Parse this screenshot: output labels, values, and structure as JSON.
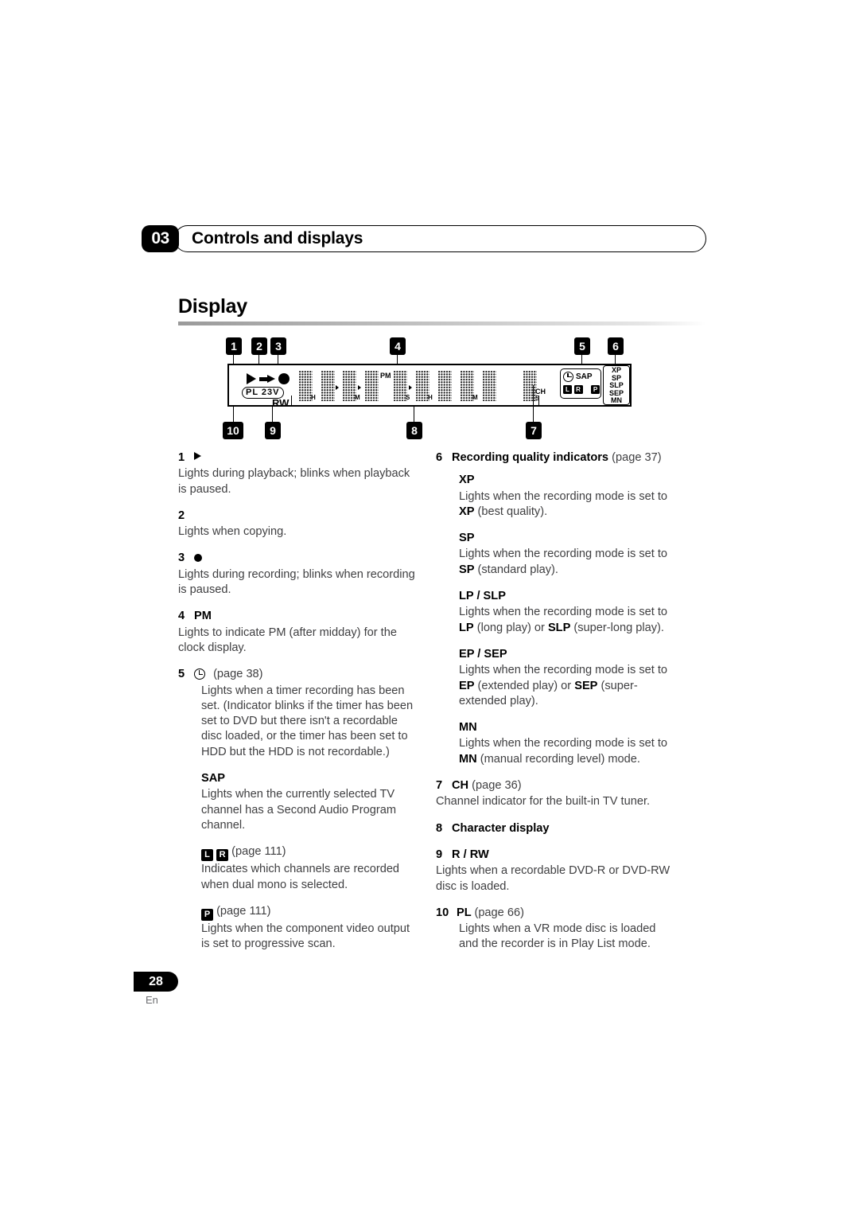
{
  "header": {
    "chapter_number": "03",
    "chapter_title": "Controls and displays"
  },
  "section": {
    "title": "Display"
  },
  "diagram": {
    "name": "front-panel-display-diagram",
    "callouts": [
      "1",
      "2",
      "3",
      "4",
      "5",
      "6",
      "7",
      "8",
      "9",
      "10"
    ],
    "panel": {
      "play_icon": "play-triangle-icon",
      "copy_icon": "copy-arrow-icon",
      "record_icon": "record-dot-icon",
      "pl_box_text": "PL 23V",
      "rw_label": "RW",
      "pm_label": "PM",
      "ch_label": "CH",
      "unit_labels": [
        "H",
        "M",
        "S",
        "H",
        "M",
        "S"
      ],
      "status": {
        "clock_icon": "clock-icon",
        "sap_label": "SAP",
        "channel_boxes": [
          "L",
          "R",
          "P"
        ]
      },
      "quality_indicators": [
        "XP",
        "SP",
        "SLP",
        "SEP",
        "MN"
      ]
    }
  },
  "left_column": [
    {
      "num": "1",
      "glyph": "play-triangle-icon",
      "label": "",
      "page": "",
      "body": "Lights during playback; blinks when playback is paused."
    },
    {
      "num": "2",
      "glyph": "copy-arrow-icon",
      "label": "",
      "page": "",
      "body": "Lights when copying."
    },
    {
      "num": "3",
      "glyph": "record-dot-icon",
      "label": "",
      "page": "",
      "body": "Lights during recording; blinks when recording is paused."
    },
    {
      "num": "4",
      "glyph": "",
      "label": "PM",
      "page": "",
      "body": "Lights to indicate PM (after midday) for the clock display."
    },
    {
      "num": "5",
      "glyph": "clock-icon",
      "label": "",
      "page": "(page 38)",
      "body": "Lights when a timer recording has been set. (Indicator blinks if the timer has been set to DVD but there isn't a recordable disc loaded, or the timer has been set to HDD but the HDD is not recordable.)"
    }
  ],
  "left_column_subitems": [
    {
      "head": "SAP",
      "page": "",
      "body": "Lights when the currently selected TV channel has a Second Audio Program channel."
    },
    {
      "head": "L R",
      "head_icons": [
        "L",
        "R"
      ],
      "page": "(page 111)",
      "body": "Indicates which channels are recorded when dual mono is selected."
    },
    {
      "head": "P",
      "head_icons": [
        "P"
      ],
      "page": "(page 111)",
      "body": "Lights when the component video output is set to progressive scan."
    }
  ],
  "right_column": {
    "item6": {
      "num": "6",
      "label": "Recording quality indicators",
      "page": "(page 37)",
      "modes": [
        {
          "head": "XP",
          "body_pre": "Lights when the recording mode is set to ",
          "body_bold": "XP",
          "body_post": " (best quality)."
        },
        {
          "head": "SP",
          "body_pre": "Lights when the recording mode is set to ",
          "body_bold": "SP",
          "body_post": " (standard play)."
        },
        {
          "head": "LP / SLP",
          "body_pre": "Lights when the recording mode is set to ",
          "body_bold": "LP",
          "body_mid": " (long play) or ",
          "body_bold2": "SLP",
          "body_post": " (super-long play)."
        },
        {
          "head": "EP / SEP",
          "body_pre": "Lights when the recording mode is set to ",
          "body_bold": "EP",
          "body_mid": " (extended play) or ",
          "body_bold2": "SEP",
          "body_post": " (super-extended play)."
        },
        {
          "head": "MN",
          "body_pre": "Lights when the recording mode is set to ",
          "body_bold": "MN",
          "body_post": " (manual recording level) mode."
        }
      ]
    },
    "item7": {
      "num": "7",
      "label": "CH",
      "page": "(page 36)",
      "body": "Channel indicator for the built-in TV tuner."
    },
    "item8": {
      "num": "8",
      "label": "Character display",
      "page": "",
      "body": ""
    },
    "item9": {
      "num": "9",
      "label": "R / RW",
      "page": "",
      "body": "Lights when a recordable DVD-R or DVD-RW disc is loaded."
    },
    "item10": {
      "num": "10",
      "label": "PL",
      "page": "(page 66)",
      "body": "Lights when a VR mode disc is loaded and the recorder is in Play List mode."
    }
  },
  "footer": {
    "page_number": "28",
    "language": "En"
  }
}
